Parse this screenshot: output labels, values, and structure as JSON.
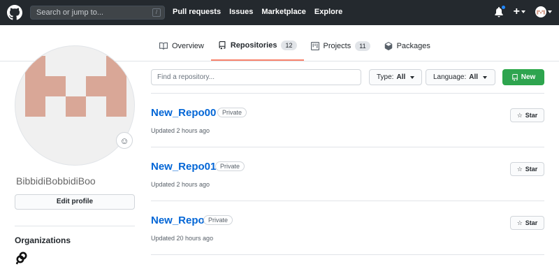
{
  "header": {
    "search_placeholder": "Search or jump to...",
    "search_shortcut": "/",
    "nav": [
      "Pull requests",
      "Issues",
      "Marketplace",
      "Explore"
    ],
    "plus_label": "+"
  },
  "tabs": [
    {
      "label": "Overview",
      "icon": "book-icon",
      "count": null
    },
    {
      "label": "Repositories",
      "icon": "repo-icon",
      "count": "12"
    },
    {
      "label": "Projects",
      "icon": "project-icon",
      "count": "11"
    },
    {
      "label": "Packages",
      "icon": "package-icon",
      "count": null
    }
  ],
  "profile": {
    "username": "BibbidiBobbidiBoo",
    "edit_label": "Edit profile",
    "orgs_title": "Organizations",
    "emoji_glyph": "☺"
  },
  "filters": {
    "find_placeholder": "Find a repository...",
    "type_label": "Type:",
    "type_value": "All",
    "language_label": "Language:",
    "language_value": "All",
    "new_label": "New"
  },
  "repos": [
    {
      "name": "New_Repo00",
      "visibility": "Private",
      "updated": "Updated 2 hours ago",
      "star_label": "Star"
    },
    {
      "name": "New_Repo01",
      "visibility": "Private",
      "updated": "Updated 2 hours ago",
      "star_label": "Star"
    },
    {
      "name": "New_Repo",
      "visibility": "Private",
      "updated": "Updated 20 hours ago",
      "star_label": "Star"
    }
  ],
  "colors": {
    "header_bg": "#24292e",
    "link": "#0366d6",
    "new_button": "#2ea44f",
    "active_tab_underline": "#f9826c",
    "avatar_pattern": "#d9a797",
    "notification_dot": "#2188ff"
  }
}
